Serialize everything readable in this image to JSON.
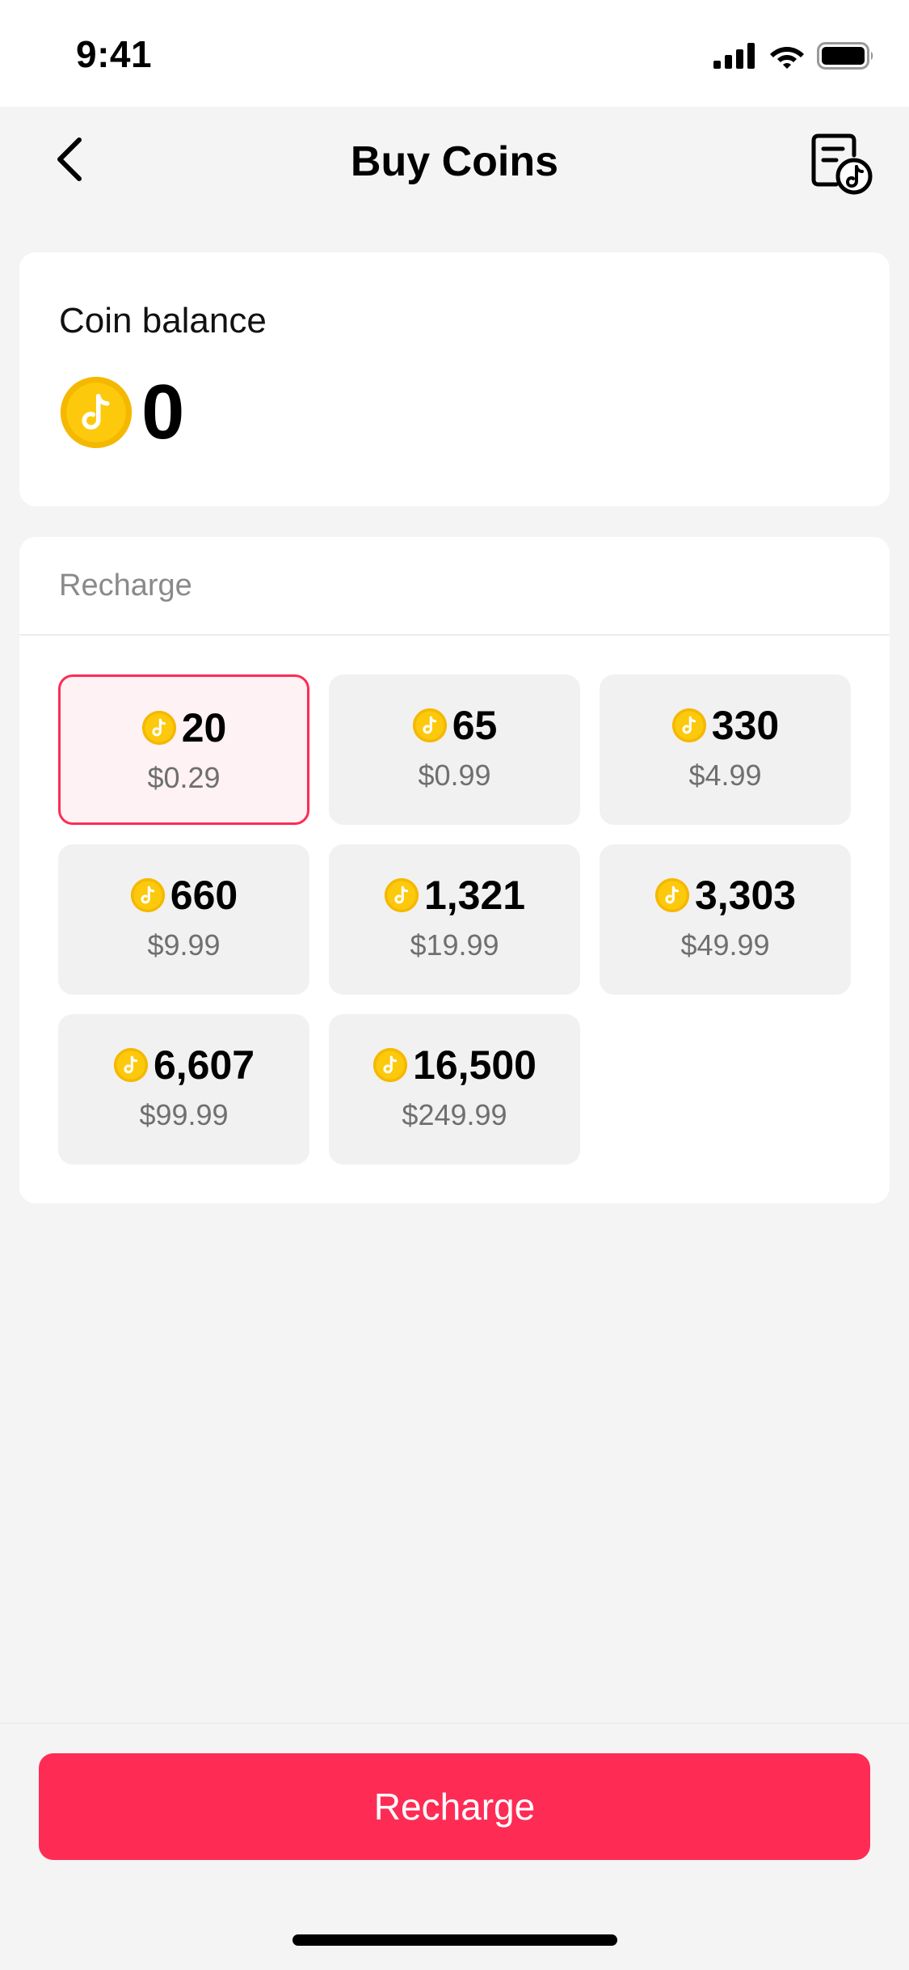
{
  "status_bar": {
    "time": "9:41"
  },
  "nav": {
    "title": "Buy Coins"
  },
  "balance": {
    "label": "Coin balance",
    "value": "0"
  },
  "recharge_section": {
    "heading": "Recharge"
  },
  "packages": [
    {
      "coins": "20",
      "price": "$0.29",
      "selected": true
    },
    {
      "coins": "65",
      "price": "$0.99",
      "selected": false
    },
    {
      "coins": "330",
      "price": "$4.99",
      "selected": false
    },
    {
      "coins": "660",
      "price": "$9.99",
      "selected": false
    },
    {
      "coins": "1,321",
      "price": "$19.99",
      "selected": false
    },
    {
      "coins": "3,303",
      "price": "$49.99",
      "selected": false
    },
    {
      "coins": "6,607",
      "price": "$99.99",
      "selected": false
    },
    {
      "coins": "16,500",
      "price": "$249.99",
      "selected": false
    }
  ],
  "bottom": {
    "recharge_button": "Recharge"
  },
  "icons": {
    "back": "chevron-left-icon",
    "history": "transaction-history-icon",
    "coin": "coin-icon"
  },
  "colors": {
    "accent": "#fe2c55",
    "selected_bg": "#fff2f4",
    "coin_gold": "#fdc90c",
    "coin_rim": "#f5b800",
    "background": "#f4f4f4"
  }
}
